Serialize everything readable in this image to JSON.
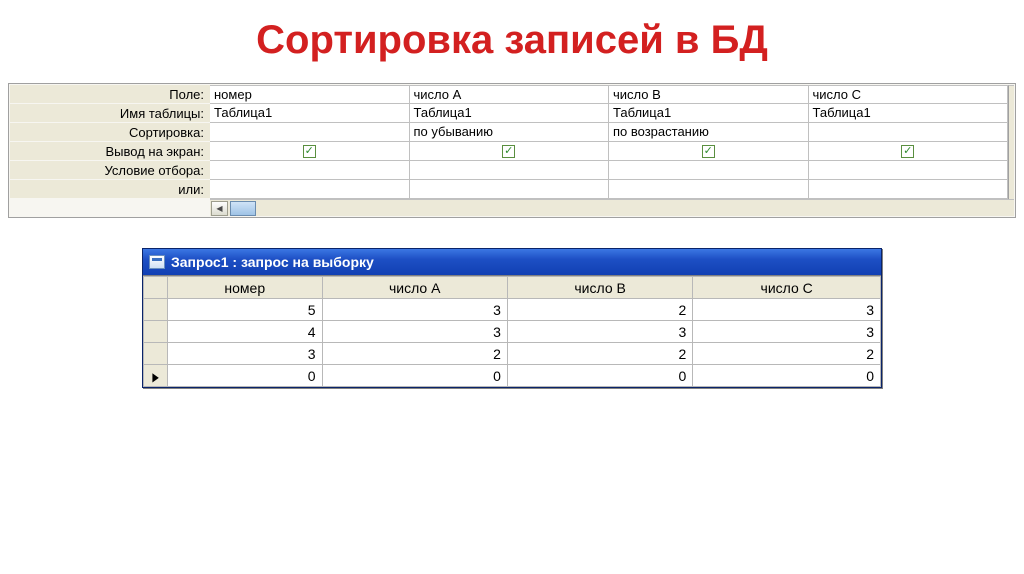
{
  "title": "Сортировка записей в БД",
  "design": {
    "labels": {
      "field": "Поле:",
      "table": "Имя таблицы:",
      "sort": "Сортировка:",
      "show": "Вывод на экран:",
      "criteria": "Условие отбора:",
      "or": "или:"
    },
    "columns": [
      {
        "field": "номер",
        "table": "Таблица1",
        "sort": "",
        "show": true
      },
      {
        "field": "число А",
        "table": "Таблица1",
        "sort": "по убыванию",
        "show": true
      },
      {
        "field": "число В",
        "table": "Таблица1",
        "sort": "по возрастанию",
        "show": true
      },
      {
        "field": "число С",
        "table": "Таблица1",
        "sort": "",
        "show": true
      }
    ]
  },
  "result": {
    "window_title": "Запрос1 : запрос на выборку",
    "headers": [
      "номер",
      "число А",
      "число В",
      "число С"
    ],
    "rows": [
      {
        "marker": "",
        "values": [
          5,
          3,
          2,
          3
        ]
      },
      {
        "marker": "",
        "values": [
          4,
          3,
          3,
          3
        ]
      },
      {
        "marker": "",
        "values": [
          3,
          2,
          2,
          2
        ]
      },
      {
        "marker": "▶",
        "values": [
          0,
          0,
          0,
          0
        ]
      }
    ]
  }
}
